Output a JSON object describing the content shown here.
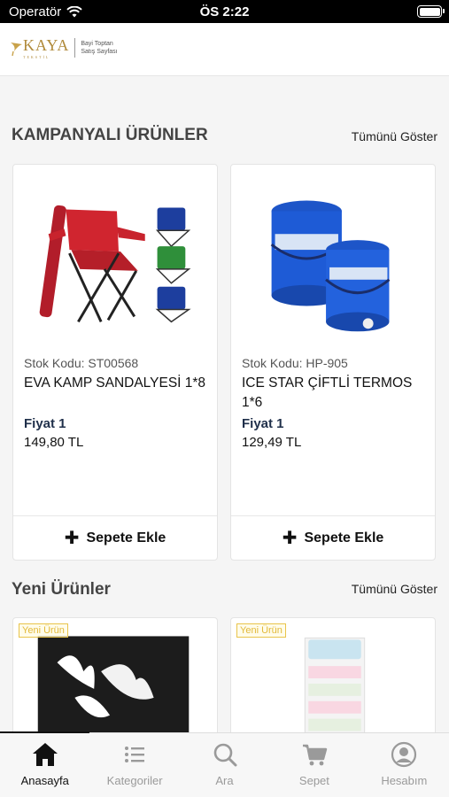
{
  "status": {
    "carrier": "Operatör",
    "time": "ÖS 2:22"
  },
  "header": {
    "logo_text": "KAYA",
    "logo_sub": "TEKSTİL",
    "tagline_1": "Bayi Toptan",
    "tagline_2": "Satış Sayfası"
  },
  "campaign": {
    "title": "KAMPANYALI ÜRÜNLER",
    "show_all": "Tümünü Göster",
    "products": [
      {
        "code": "Stok Kodu: ST00568",
        "name": "EVA KAMP SANDALYESİ 1*8",
        "price_label": "Fiyat 1",
        "price": "149,80 TL",
        "cart_label": "Sepete Ekle"
      },
      {
        "code": "Stok Kodu: HP-905",
        "name": "ICE STAR ÇİFTLİ TERMOS 1*6",
        "price_label": "Fiyat 1",
        "price": "129,49 TL",
        "cart_label": "Sepete Ekle"
      }
    ]
  },
  "new_products": {
    "title": "Yeni Ürünler",
    "show_all": "Tümünü Göster",
    "badge": "Yeni Ürün"
  },
  "tabs": [
    {
      "label": "Anasayfa",
      "icon": "home-icon"
    },
    {
      "label": "Kategoriler",
      "icon": "list-icon"
    },
    {
      "label": "Ara",
      "icon": "search-icon"
    },
    {
      "label": "Sepet",
      "icon": "cart-icon"
    },
    {
      "label": "Hesabım",
      "icon": "account-icon"
    }
  ],
  "colors": {
    "price_label": "#1f2f4a",
    "badge": "#e2b93a",
    "brand": "#b08a3a"
  }
}
